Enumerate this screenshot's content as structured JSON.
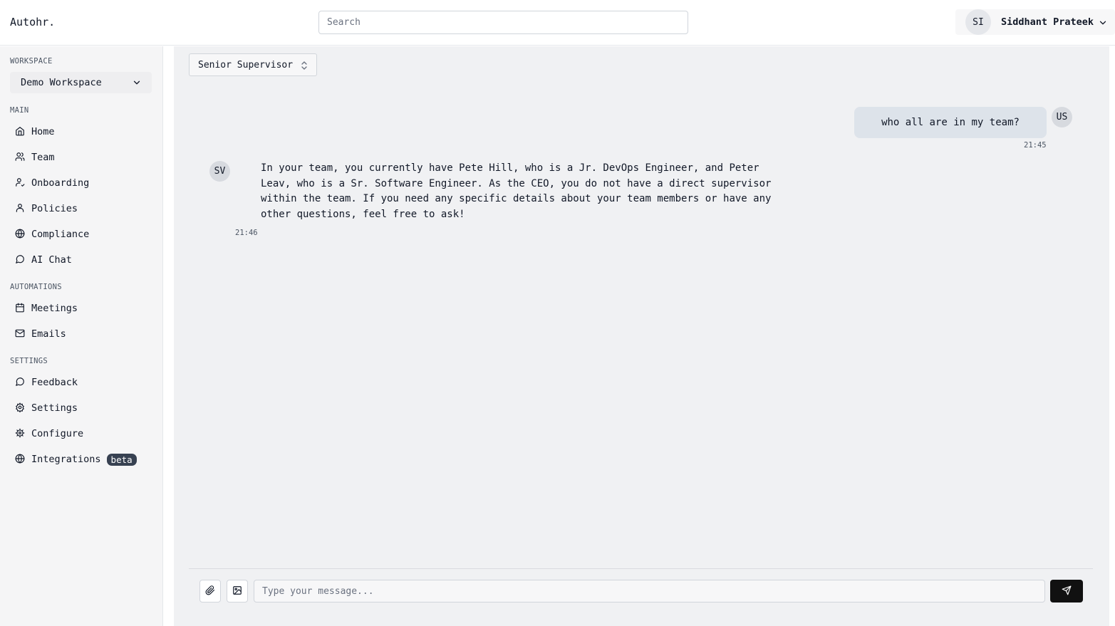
{
  "brand": "Autohr.",
  "search": {
    "placeholder": "Search"
  },
  "user": {
    "initials": "SI",
    "name": "Siddhant Prateek"
  },
  "sidebar": {
    "workspace_label": "WORKSPACE",
    "workspace_value": "Demo Workspace",
    "main_label": "MAIN",
    "main_items": [
      {
        "label": "Home",
        "icon": "home-icon"
      },
      {
        "label": "Team",
        "icon": "users-icon"
      },
      {
        "label": "Onboarding",
        "icon": "user-check-icon"
      },
      {
        "label": "Policies",
        "icon": "user-icon"
      },
      {
        "label": "Compliance",
        "icon": "globe-icon"
      },
      {
        "label": "AI Chat",
        "icon": "message-circle-icon"
      }
    ],
    "automations_label": "AUTOMATIONS",
    "automation_items": [
      {
        "label": "Meetings",
        "icon": "calendar-icon"
      },
      {
        "label": "Emails",
        "icon": "mail-icon"
      }
    ],
    "settings_label": "SETTINGS",
    "settings_items": [
      {
        "label": "Feedback",
        "icon": "message-circle-icon"
      },
      {
        "label": "Settings",
        "icon": "gear-icon"
      },
      {
        "label": "Configure",
        "icon": "cog-icon"
      },
      {
        "label": "Integrations",
        "icon": "globe-icon",
        "badge": "beta"
      }
    ]
  },
  "chat": {
    "role_select": "Senior Supervisor",
    "messages": [
      {
        "from": "user",
        "avatar": "US",
        "text": "who all are in my team?",
        "time": "21:45"
      },
      {
        "from": "bot",
        "avatar": "SV",
        "text": "In your team, you currently have Pete Hill, who is a Jr. DevOps Engineer, and Peter Leav, who is a Sr. Software Engineer. As the CEO, you do not have a direct supervisor within the team. If you need any specific details about your team members or have any other questions, feel free to ask!",
        "time": "21:46"
      }
    ],
    "input_placeholder": "Type your message..."
  },
  "colors": {
    "send_button": "#111111",
    "user_bubble": "#dde3ea",
    "main_bg": "#f0f1f3",
    "sidebar_bg": "#f5f5f6"
  }
}
